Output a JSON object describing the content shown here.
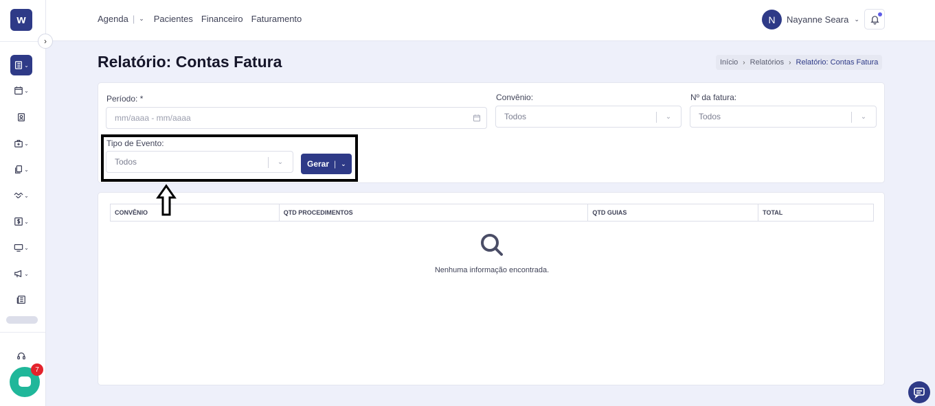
{
  "app": {
    "logo_text": "w"
  },
  "topnav": {
    "items": [
      {
        "label": "Agenda"
      },
      {
        "label": "Pacientes"
      },
      {
        "label": "Financeiro"
      },
      {
        "label": "Faturamento"
      }
    ],
    "pipe": "|"
  },
  "user": {
    "initial": "N",
    "name": "Nayanne Seara"
  },
  "chat": {
    "badge_count": "7"
  },
  "page": {
    "title": "Relatório: Contas Fatura",
    "breadcrumb": [
      "Início",
      "Relatórios",
      "Relatório: Contas Fatura"
    ]
  },
  "filters": {
    "periodo": {
      "label": "Período: *",
      "placeholder": "mm/aaaa - mm/aaaa"
    },
    "convenio": {
      "label": "Convênio:",
      "value": "Todos"
    },
    "fatura": {
      "label": "Nº da fatura:",
      "value": "Todos"
    },
    "tipo_evento": {
      "label": "Tipo de Evento:",
      "value": "Todos"
    },
    "gerar_label": "Gerar",
    "gerar_pipe": "|"
  },
  "table": {
    "columns": [
      "CONVÊNIO",
      "QTD PROCEDIMENTOS",
      "QTD GUIAS",
      "TOTAL"
    ],
    "empty_message": "Nenhuma informação encontrada."
  },
  "sidebar_icons": [
    "notebook-icon",
    "calendar-icon",
    "patient-badge-icon",
    "medical-kit-icon",
    "documents-icon",
    "handshake-icon",
    "dollar-icon",
    "monitor-icon",
    "megaphone-icon",
    "newspaper-icon",
    "headset-icon"
  ],
  "colors": {
    "primary": "#2e3a87",
    "chat": "#20b79a",
    "badge": "#e3232c",
    "background": "#eef0fa"
  }
}
